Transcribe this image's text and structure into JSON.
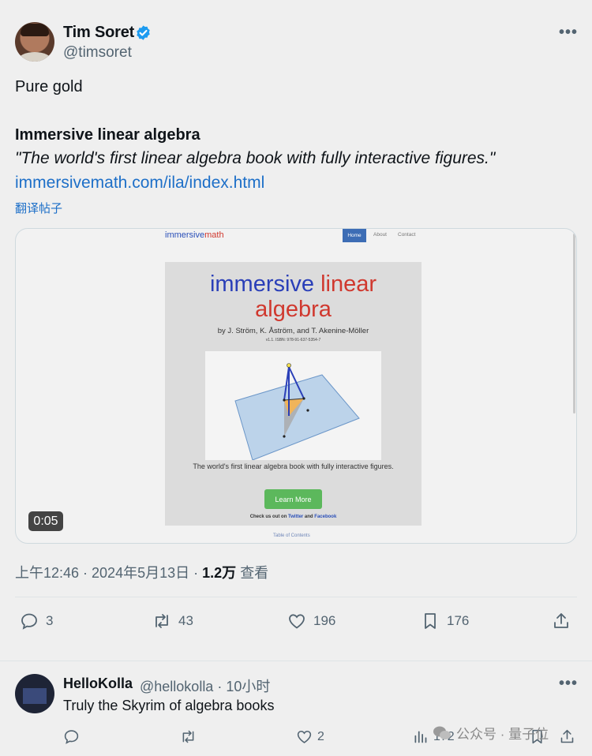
{
  "tweet": {
    "author_name": "Tim Soret",
    "handle": "@timsoret",
    "text": "Pure gold",
    "card_title": "Immersive linear algebra",
    "quote": "\"The world's first linear algebra book with fully interactive figures.\"",
    "link": "immersivemath.com/ila/index.html",
    "translate": "翻译帖子",
    "timestamp": "上午12:46 · 2024年5月13日 ·",
    "views_count": "1.2万",
    "views_label": "查看",
    "more_label": "•••"
  },
  "media": {
    "duration": "0:05",
    "site_logo_a": "immersive",
    "site_logo_b": "math",
    "nav": [
      "Home",
      "About",
      "Contact"
    ],
    "hero_title_a": "immersive ",
    "hero_title_b": "linear",
    "hero_title_c": "algebra",
    "authors": "by J. Ström, K. Åström, and T. Akenine-Möller",
    "isbn": "v1.1. ISBN: 978-91-637-5354-7",
    "tagline": "The world's first linear algebra book with fully interactive figures.",
    "learn_more": "Learn More",
    "check_prefix": "Check us out on ",
    "twitter": "Twitter",
    "and": " and ",
    "facebook": "Facebook",
    "toc": "Table of Contents"
  },
  "actions": {
    "replies": "3",
    "retweets": "43",
    "likes": "196",
    "bookmarks": "176"
  },
  "reply": {
    "name": "HelloKolla",
    "handle_time": "@hellokolla · 10小时",
    "text": "Truly the Skyrim of algebra books",
    "likes": "2",
    "views": "172",
    "more_label": "•••"
  },
  "watermark": "公众号 · 量子位",
  "colors": {
    "link": "#1d6fc8",
    "verified": "#1d9bf0",
    "muted": "#536471"
  }
}
